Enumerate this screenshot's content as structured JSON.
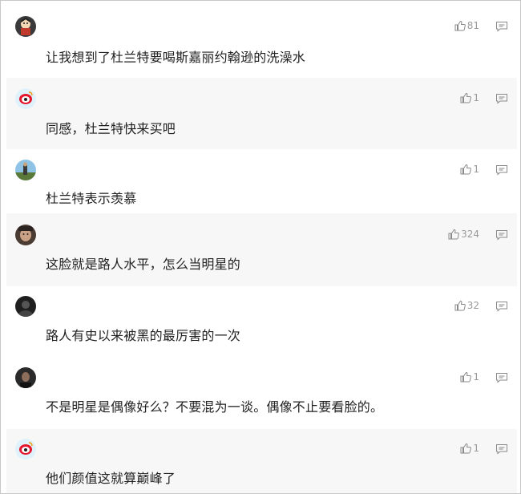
{
  "comments": [
    {
      "user": "",
      "avatar": "cartoon-character-avatar",
      "text": "让我想到了杜兰特要喝斯嘉丽约翰逊的洗澡水",
      "likes": "81"
    },
    {
      "user": "",
      "avatar": "weibo-default-avatar",
      "text": "同感，杜兰特快来买吧",
      "likes": "1"
    },
    {
      "user": "",
      "avatar": "outdoor-photo-avatar",
      "text": "杜兰特表示羡慕",
      "likes": "1"
    },
    {
      "user": "",
      "avatar": "portrait-photo-avatar",
      "text": "这脸就是路人水平，怎么当明星的",
      "likes": "324"
    },
    {
      "user": "",
      "avatar": "dark-photo-avatar",
      "text": "路人有史以来被黑的最厉害的一次",
      "likes": "32"
    },
    {
      "user": "",
      "avatar": "person-photo-avatar",
      "text": "不是明星是偶像好么？不要混为一谈。偶像不止要看脸的。",
      "likes": "1"
    },
    {
      "user": "",
      "avatar": "weibo-default-avatar",
      "text": "他们颜值这就算巅峰了",
      "likes": "1"
    }
  ],
  "colors": {
    "text": "#222222",
    "meta": "#9a9a9a",
    "alt_row_bg": "#f7f7f7",
    "weibo_red": "#e6162d"
  },
  "icons": {
    "like": "thumbs-up-icon",
    "reply": "comment-bubble-icon"
  }
}
